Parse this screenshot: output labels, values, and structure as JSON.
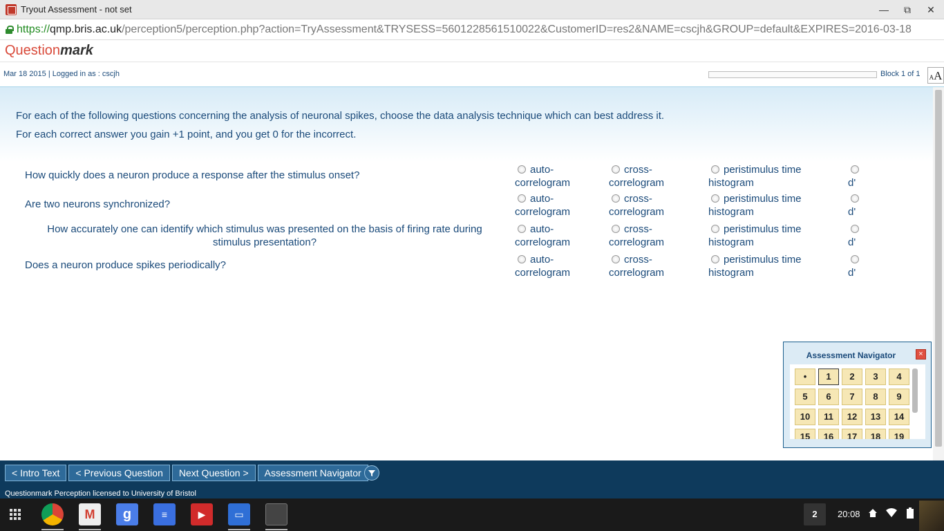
{
  "window": {
    "title": "Tryout Assessment - not set",
    "minimize_icon": "minimize-icon",
    "restore_icon": "restore-icon",
    "close_icon": "close-icon"
  },
  "address": {
    "scheme": "https://",
    "host": "qmp.bris.ac.uk",
    "path": "/perception5/perception.php?action=TryAssessment&TRYSESS=5601228561510022&CustomerID=res2&NAME=cscjh&GROUP=default&EXPIRES=2016-03-18"
  },
  "logo": {
    "part1": "Question",
    "part2": "mark"
  },
  "info": {
    "date": "Mar 18 2015",
    "separator": "|",
    "logged_in": "Logged in as : cscjh",
    "block": "Block 1 of 1",
    "font_small": "A",
    "font_large": "A"
  },
  "intro": {
    "line1": "For each of the following questions concerning the analysis of neuronal spikes, choose the data analysis technique which can best address it.",
    "line2": "For each correct answer you gain +1 point, and you get 0 for the incorrect."
  },
  "options": {
    "opt1_a": "auto-",
    "opt1_b": "correlogram",
    "opt2_a": "cross-",
    "opt2_b": "correlogram",
    "opt3_a": "peristimulus time",
    "opt3_b": "histogram",
    "opt4": "d'"
  },
  "questions": [
    {
      "text": "How quickly does a neuron produce a response after the stimulus onset?"
    },
    {
      "text": "Are two neurons synchronized?"
    },
    {
      "line1": "How accurately one can identify which stimulus was presented on the basis of firing rate during",
      "line2": "stimulus presentation?"
    },
    {
      "text": "Does a neuron produce spikes periodically?"
    }
  ],
  "navigator": {
    "title": "Assessment Navigator",
    "close_label": "×",
    "cells": [
      "•",
      "1",
      "2",
      "3",
      "4",
      "5",
      "6",
      "7",
      "8",
      "9",
      "10",
      "11",
      "12",
      "13",
      "14",
      "15",
      "16",
      "17",
      "18",
      "19"
    ]
  },
  "toolbar": {
    "intro_text": "< Intro Text",
    "prev": "< Previous Question",
    "next": "Next Question >",
    "navigator": "Assessment Navigator",
    "help_icon": "help-icon",
    "footer": "Questionmark Perception licensed to University of Bristol"
  },
  "taskbar": {
    "badge": "2",
    "time": "20:08"
  },
  "colors": {
    "accent": "#1a4a7a",
    "toolbar_bg": "#0e3a5c",
    "logo_red": "#d94a3a",
    "nav_cell": "#f6e7b5"
  }
}
